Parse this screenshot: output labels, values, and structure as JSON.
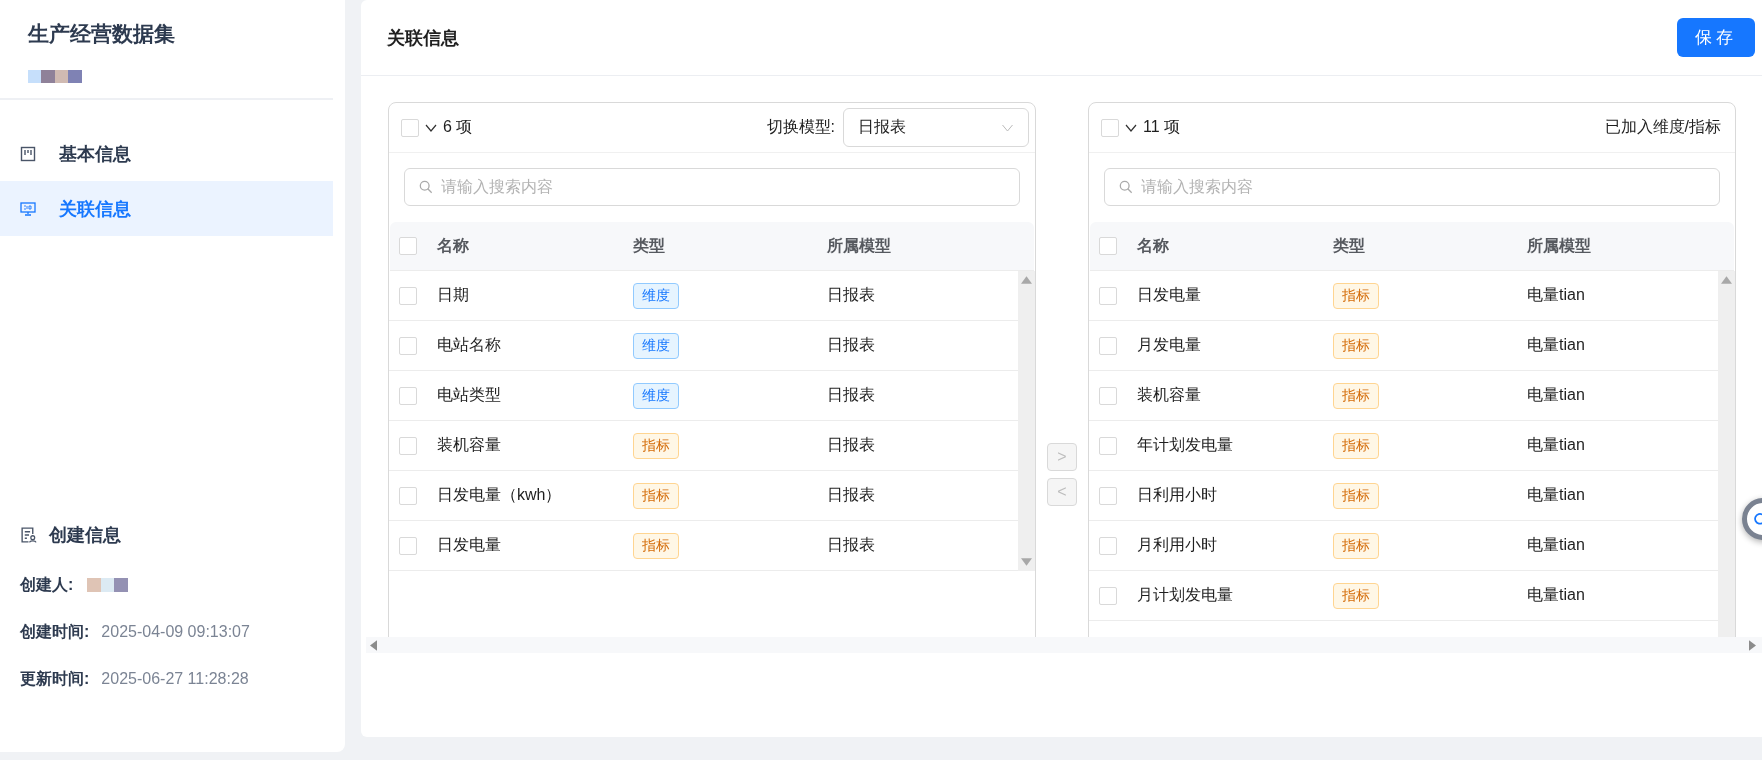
{
  "sidebar": {
    "title": "生产经营数据集",
    "menu": [
      {
        "label": "基本信息",
        "selected": false
      },
      {
        "label": "关联信息",
        "selected": true
      }
    ],
    "creation": {
      "heading": "创建信息",
      "fields": [
        {
          "label": "创建人:",
          "kind": "redacted"
        },
        {
          "label": "创建时间:",
          "value": "2025-04-09 09:13:07",
          "kind": "text"
        },
        {
          "label": "更新时间:",
          "value": "2025-06-27 11:28:28",
          "kind": "text"
        }
      ]
    }
  },
  "header": {
    "title": "关联信息",
    "save": "保存"
  },
  "transfer": {
    "source": {
      "checked": false,
      "count": "6 项",
      "switch_label": "切换模型:",
      "select_value": "日报表",
      "search_placeholder": "请输入搜索内容",
      "all_checked": false,
      "columns": [
        "名称",
        "类型",
        "所属模型"
      ],
      "rows": [
        {
          "name": "日期",
          "type": {
            "label": "维度",
            "kind": "dimension"
          },
          "model": "日报表",
          "checked": false
        },
        {
          "name": "电站名称",
          "type": {
            "label": "维度",
            "kind": "dimension"
          },
          "model": "日报表",
          "checked": false
        },
        {
          "name": "电站类型",
          "type": {
            "label": "维度",
            "kind": "dimension"
          },
          "model": "日报表",
          "checked": false
        },
        {
          "name": "装机容量",
          "type": {
            "label": "指标",
            "kind": "metric"
          },
          "model": "日报表",
          "checked": false
        },
        {
          "name": "日发电量（kwh）",
          "type": {
            "label": "指标",
            "kind": "metric"
          },
          "model": "日报表",
          "checked": false
        },
        {
          "name": "日发电量",
          "type": {
            "label": "指标",
            "kind": "metric"
          },
          "model": "日报表",
          "checked": false
        }
      ]
    },
    "buttons": [
      {
        "label": ">",
        "disabled": true
      },
      {
        "label": "<",
        "disabled": true
      }
    ],
    "target": {
      "checked": false,
      "count": "11 项",
      "title": "已加入维度/指标",
      "search_placeholder": "请输入搜索内容",
      "all_checked": false,
      "columns": [
        "名称",
        "类型",
        "所属模型"
      ],
      "rows": [
        {
          "name": "日发电量",
          "type": {
            "label": "指标",
            "kind": "metric"
          },
          "model": "电量tian",
          "checked": false
        },
        {
          "name": "月发电量",
          "type": {
            "label": "指标",
            "kind": "metric"
          },
          "model": "电量tian",
          "checked": false
        },
        {
          "name": "装机容量",
          "type": {
            "label": "指标",
            "kind": "metric"
          },
          "model": "电量tian",
          "checked": false
        },
        {
          "name": "年计划发电量",
          "type": {
            "label": "指标",
            "kind": "metric"
          },
          "model": "电量tian",
          "checked": false
        },
        {
          "name": "日利用小时",
          "type": {
            "label": "指标",
            "kind": "metric"
          },
          "model": "电量tian",
          "checked": false
        },
        {
          "name": "月利用小时",
          "type": {
            "label": "指标",
            "kind": "metric"
          },
          "model": "电量tian",
          "checked": false
        },
        {
          "name": "月计划发电量",
          "type": {
            "label": "指标",
            "kind": "metric"
          },
          "model": "电量tian",
          "checked": false
        }
      ]
    }
  }
}
